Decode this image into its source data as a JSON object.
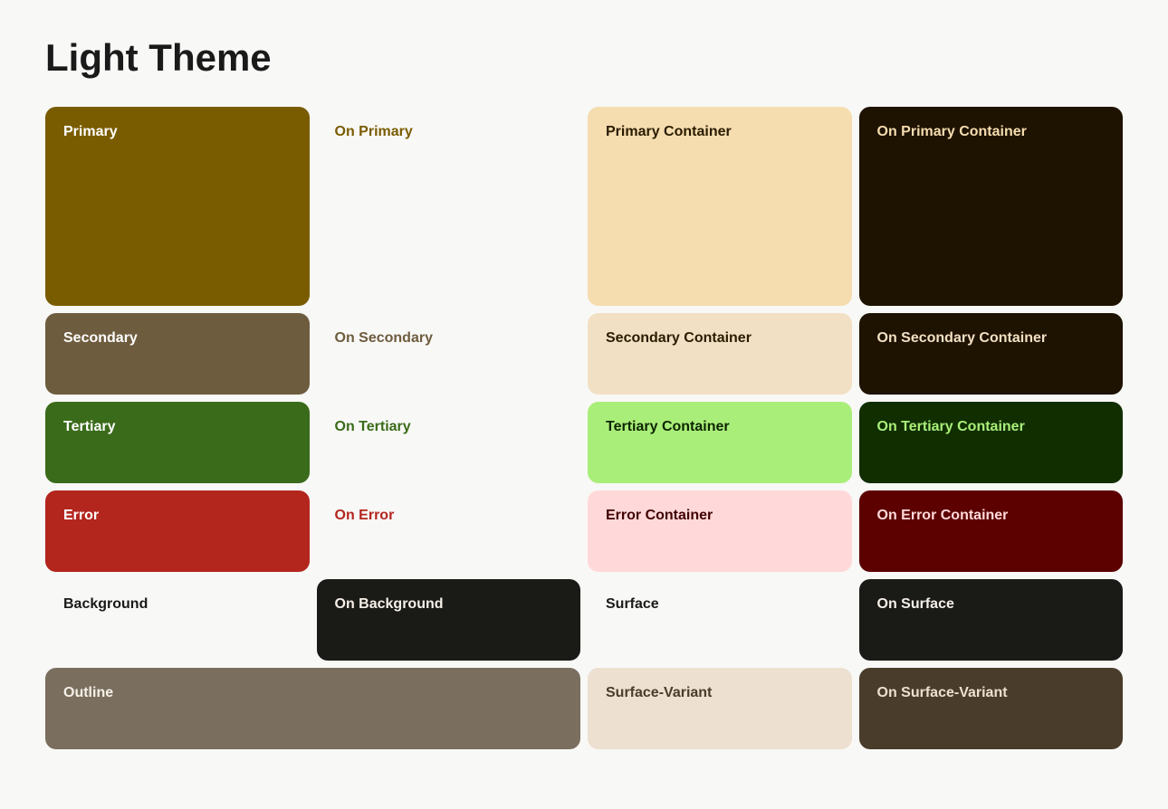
{
  "title": "Light Theme",
  "rows": [
    {
      "cells": [
        {
          "label": "Primary",
          "class": "primary tall"
        },
        {
          "label": "On Primary",
          "class": "on-primary tall"
        },
        {
          "label": "Primary Container",
          "class": "primary-container tall"
        },
        {
          "label": "On Primary Container",
          "class": "on-primary-container tall"
        }
      ]
    },
    {
      "cells": [
        {
          "label": "Secondary",
          "class": "secondary"
        },
        {
          "label": "On Secondary",
          "class": "on-secondary"
        },
        {
          "label": "Secondary Container",
          "class": "secondary-container"
        },
        {
          "label": "On Secondary Container",
          "class": "on-secondary-container"
        }
      ]
    },
    {
      "cells": [
        {
          "label": "Tertiary",
          "class": "tertiary"
        },
        {
          "label": "On Tertiary",
          "class": "on-tertiary"
        },
        {
          "label": "Tertiary Container",
          "class": "tertiary-container"
        },
        {
          "label": "On Tertiary Container",
          "class": "on-tertiary-container"
        }
      ]
    },
    {
      "cells": [
        {
          "label": "Error",
          "class": "error"
        },
        {
          "label": "On Error",
          "class": "on-error"
        },
        {
          "label": "Error Container",
          "class": "error-container"
        },
        {
          "label": "On Error Container",
          "class": "on-error-container"
        }
      ]
    },
    {
      "cells": [
        {
          "label": "Background",
          "class": "background"
        },
        {
          "label": "On Background",
          "class": "on-background"
        },
        {
          "label": "Surface",
          "class": "surface"
        },
        {
          "label": "On Surface",
          "class": "on-surface"
        }
      ]
    },
    {
      "cells": [
        {
          "label": "Outline",
          "class": "outline span-2"
        },
        {
          "label": "Surface-Variant",
          "class": "surface-variant"
        },
        {
          "label": "On Surface-Variant",
          "class": "on-surface-variant"
        }
      ]
    }
  ]
}
